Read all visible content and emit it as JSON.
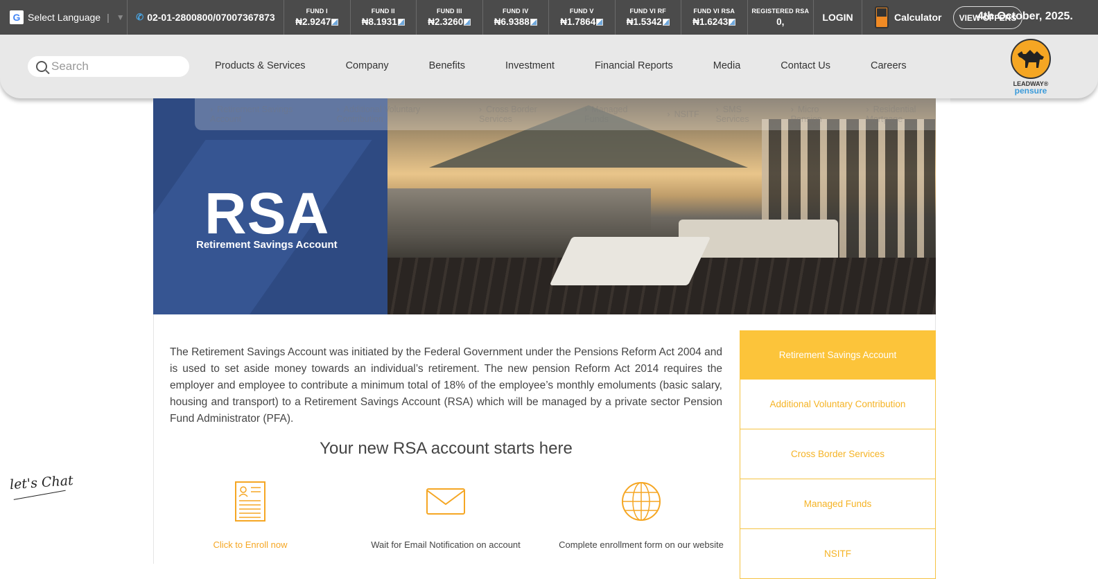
{
  "topbar": {
    "language_label": "Select Language",
    "phone": "02-01-2800800/07007367873",
    "funds": [
      {
        "name": "FUND I",
        "value": "₦2.9247"
      },
      {
        "name": "FUND II",
        "value": "₦8.1931"
      },
      {
        "name": "FUND III",
        "value": "₦2.3260"
      },
      {
        "name": "FUND IV",
        "value": "₦6.9388"
      },
      {
        "name": "FUND V",
        "value": "₦1.7864"
      },
      {
        "name": "FUND VI RF",
        "value": "₦1.5342"
      },
      {
        "name": "FUND VI RSA",
        "value": "₦1.6243"
      }
    ],
    "registered_label": "REGISTERED RSA",
    "registered_value": "0,",
    "login_label": "LOGIN",
    "calculator_label": "Calculator",
    "view_label": "VIEW OFFERS",
    "date_text": "4th October, 2025."
  },
  "nav": {
    "search_placeholder": "Search",
    "items": [
      "Products & Services",
      "Company",
      "Benefits",
      "Investment",
      "Financial Reports",
      "Media",
      "Contact Us",
      "Careers"
    ],
    "logo_line1": "LEADWAY®",
    "logo_line2": "pensure"
  },
  "subnav": {
    "items": [
      "Retirement Savings Account",
      "Additional Voluntary Contribution",
      "Cross Border Services",
      "Managed Funds",
      "NSITF",
      "SMS Services",
      "Micro Pension",
      "Residential Mortgage"
    ]
  },
  "hero": {
    "title": "RSA",
    "subtitle": "Retirement Savings Account"
  },
  "content": {
    "intro": "The Retirement Savings Account was initiated by the Federal Government under the Pensions Reform Act 2004 and is used to set aside money towards an individual’s retirement. The new pension Reform Act 2014 requires the employer and employee to contribute a minimum total of 18% of the employee’s monthly emoluments (basic salary, housing and transport) to a Retirement Savings Account (RSA) which will be managed by a private sector Pension Fund Administrator (PFA).",
    "start_title": "Your new RSA account starts here",
    "steps": [
      {
        "label": "Click to Enroll now",
        "icon": "document-icon"
      },
      {
        "label": "Wait for Email Notification on account",
        "icon": "envelope-icon"
      },
      {
        "label": "Complete enrollment form on our website",
        "icon": "globe-icon"
      }
    ]
  },
  "sidebar": {
    "items": [
      "Retirement Savings Account",
      "Additional Voluntary Contribution",
      "Cross Border Services",
      "Managed Funds",
      "NSITF"
    ]
  },
  "chat": {
    "label": "let's Chat"
  },
  "colors": {
    "accent": "#fcc43a",
    "topbar": "#4b4b4b",
    "hero_blue": "#2e4a82"
  }
}
